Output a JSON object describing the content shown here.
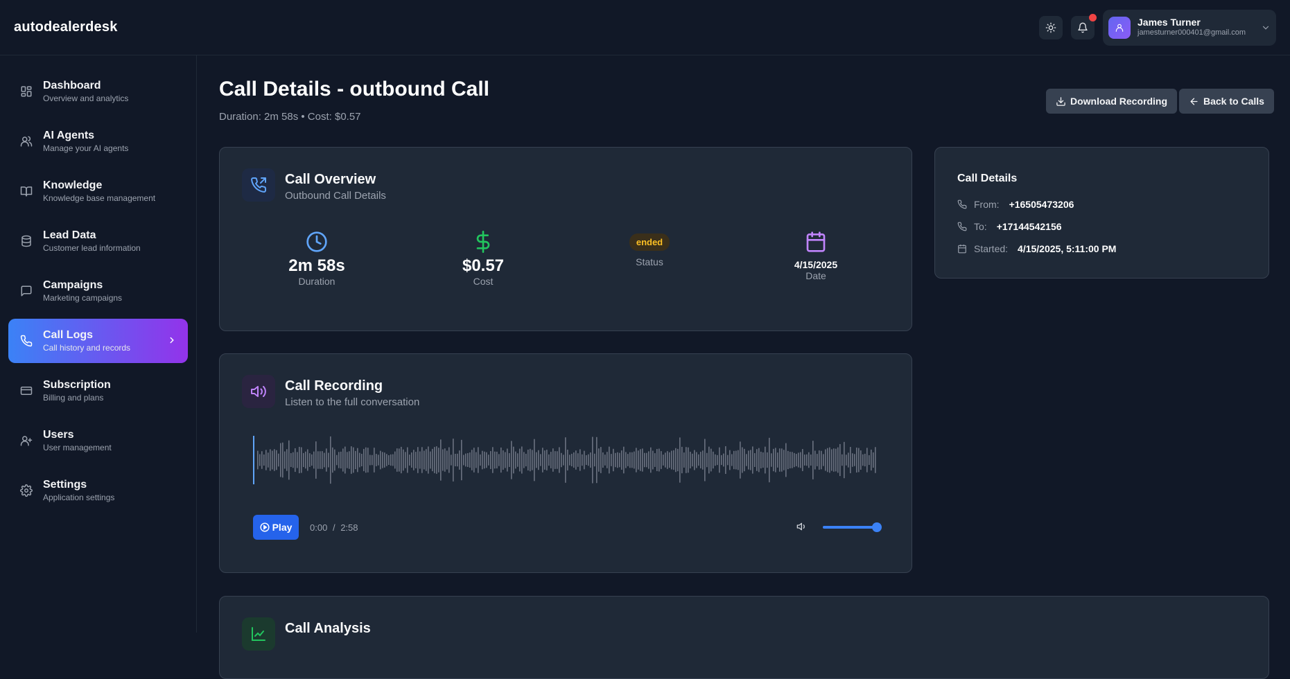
{
  "app": {
    "brand": "autodealerdesk"
  },
  "header": {
    "user": {
      "name": "James Turner",
      "email": "jamesturner000401@gmail.com"
    },
    "icons": [
      "sun-icon",
      "bell-icon",
      "user-icon",
      "chevron-down-icon"
    ],
    "notification_indicator": true
  },
  "sidebar": {
    "items": [
      {
        "label": "Dashboard",
        "sub": "Overview and analytics",
        "icon": "grid-icon"
      },
      {
        "label": "AI Agents",
        "sub": "Manage your AI agents",
        "icon": "users-icon"
      },
      {
        "label": "Knowledge",
        "sub": "Knowledge base management",
        "icon": "book-icon"
      },
      {
        "label": "Lead Data",
        "sub": "Customer lead information",
        "icon": "database-icon"
      },
      {
        "label": "Campaigns",
        "sub": "Marketing campaigns",
        "icon": "message-icon"
      },
      {
        "label": "Call Logs",
        "sub": "Call history and records",
        "icon": "phone-icon",
        "active": true
      },
      {
        "label": "Subscription",
        "sub": "Billing and plans",
        "icon": "credit-card-icon"
      },
      {
        "label": "Users",
        "sub": "User management",
        "icon": "user-plus-icon"
      },
      {
        "label": "Settings",
        "sub": "Application settings",
        "icon": "gear-icon"
      }
    ]
  },
  "page": {
    "title": "Call Details - outbound Call",
    "subtitle": "Duration: 2m 58s • Cost: $0.57",
    "download_label": "Download Recording",
    "back_label": "Back to Calls"
  },
  "overview": {
    "title": "Call Overview",
    "subtitle": "Outbound Call Details",
    "duration_value": "2m 58s",
    "duration_label": "Duration",
    "cost_value": "$0.57",
    "cost_label": "Cost",
    "status_value": "ended",
    "status_label": "Status",
    "date_value": "4/15/2025",
    "date_label": "Date"
  },
  "details": {
    "title": "Call Details",
    "from_label": "From:",
    "from_value": "+16505473206",
    "to_label": "To:",
    "to_value": "+17144542156",
    "started_label": "Started:",
    "started_value": "4/15/2025, 5:11:00 PM"
  },
  "recording": {
    "title": "Call Recording",
    "subtitle": "Listen to the full conversation",
    "play_label": "Play",
    "current_time": "0:00",
    "separator": "/",
    "total_time": "2:58",
    "volume_level": 1.0,
    "playback_progress": 0
  },
  "analysis": {
    "title": "Call Analysis"
  },
  "colors": {
    "background": "#111827",
    "card": "#1f2937",
    "accent_blue": "#3b82f6",
    "accent_purple": "#9333ea",
    "success": "#22c55e",
    "warning": "#fbbf24",
    "notification": "#ef4444"
  }
}
